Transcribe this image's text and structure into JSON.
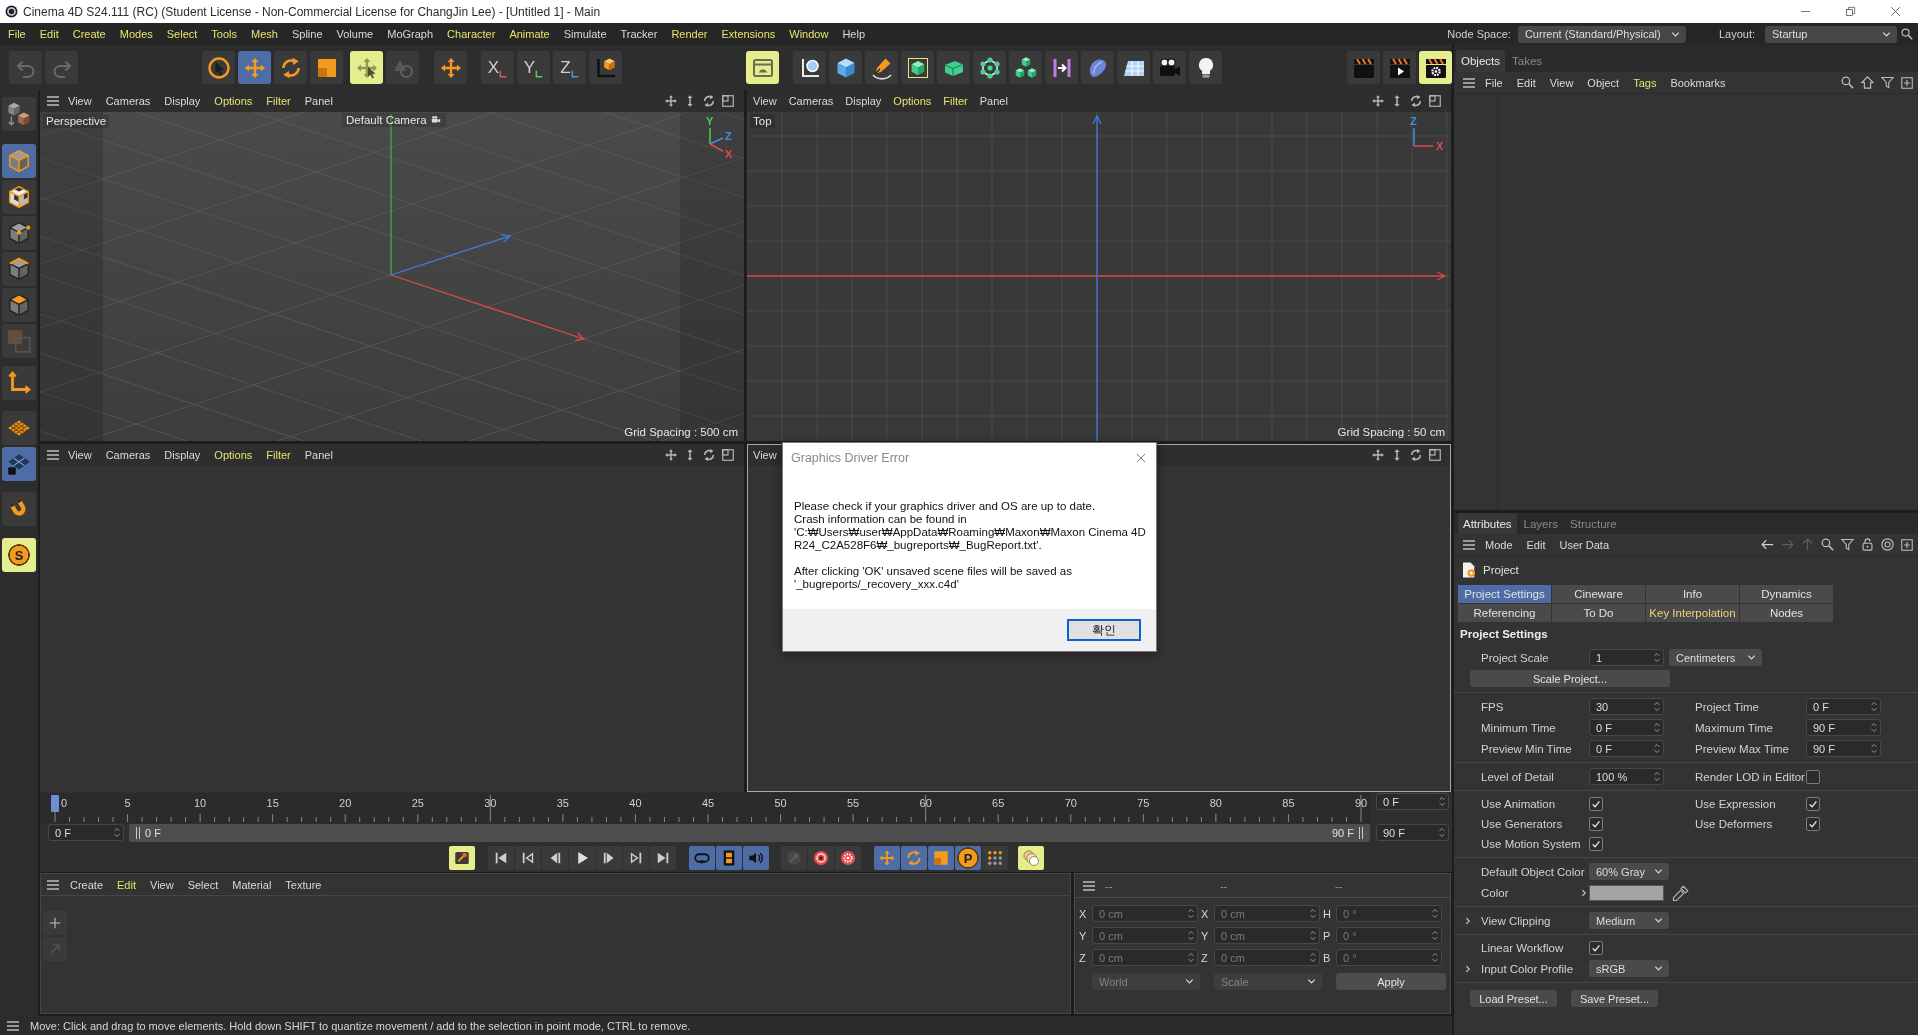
{
  "window": {
    "title": "Cinema 4D S24.111 (RC) (Student License - Non-Commercial License for ChangJin Lee) - [Untitled 1] - Main"
  },
  "menu_bar": {
    "items": [
      {
        "label": "File",
        "highlighted": true
      },
      {
        "label": "Edit",
        "highlighted": true
      },
      {
        "label": "Create",
        "highlighted": true
      },
      {
        "label": "Modes",
        "highlighted": true
      },
      {
        "label": "Select",
        "highlighted": true
      },
      {
        "label": "Tools",
        "highlighted": true
      },
      {
        "label": "Mesh",
        "highlighted": true
      },
      {
        "label": "Spline",
        "highlighted": false
      },
      {
        "label": "Volume",
        "highlighted": false
      },
      {
        "label": "MoGraph",
        "highlighted": false
      },
      {
        "label": "Character",
        "highlighted": true
      },
      {
        "label": "Animate",
        "highlighted": true
      },
      {
        "label": "Simulate",
        "highlighted": false
      },
      {
        "label": "Tracker",
        "highlighted": false
      },
      {
        "label": "Render",
        "highlighted": true
      },
      {
        "label": "Extensions",
        "highlighted": true
      },
      {
        "label": "Window",
        "highlighted": true
      },
      {
        "label": "Help",
        "highlighted": false
      }
    ],
    "node_space": {
      "label": "Node Space:",
      "value": "Current (Standard/Physical)"
    },
    "layout": {
      "label": "Layout:",
      "value": "Startup"
    }
  },
  "toolbar": {
    "groups": [
      [
        {
          "kind": "undo",
          "active": false,
          "highlighted": false,
          "disabled": true
        },
        {
          "kind": "redo",
          "active": false,
          "highlighted": false,
          "disabled": true
        }
      ],
      [
        {
          "kind": "select",
          "active": false,
          "highlighted": false,
          "disabled": false
        },
        {
          "kind": "move",
          "active": true,
          "highlighted": false,
          "disabled": false
        },
        {
          "kind": "rotate",
          "active": false,
          "highlighted": false,
          "disabled": false
        },
        {
          "kind": "scale",
          "active": false,
          "highlighted": false,
          "disabled": false
        }
      ],
      [
        {
          "kind": "live_move",
          "active": false,
          "highlighted": true,
          "disabled": false
        },
        {
          "kind": "transform",
          "active": false,
          "highlighted": false,
          "disabled": true
        }
      ],
      [
        {
          "kind": "axis_move",
          "active": false,
          "highlighted": false,
          "disabled": false
        }
      ],
      [
        {
          "kind": "axis",
          "label": "X",
          "color": "#e0585f",
          "active": false,
          "highlighted": false,
          "disabled": false
        },
        {
          "kind": "axis",
          "label": "Y",
          "color": "#5cc85c",
          "active": false,
          "highlighted": false,
          "disabled": false
        },
        {
          "kind": "axis",
          "label": "Z",
          "color": "#4f95e6",
          "active": false,
          "highlighted": false,
          "disabled": false
        },
        {
          "kind": "coord_system",
          "active": false,
          "highlighted": false,
          "disabled": false
        }
      ],
      [
        {
          "kind": "panel",
          "active": false,
          "highlighted": true,
          "disabled": false
        }
      ],
      [
        {
          "kind": "spline",
          "active": false,
          "highlighted": false,
          "disabled": false
        },
        {
          "kind": "cube",
          "active": false,
          "highlighted": false,
          "disabled": false
        },
        {
          "kind": "pen",
          "active": false,
          "highlighted": false,
          "disabled": false
        },
        {
          "kind": "subdivision",
          "active": false,
          "highlighted": false,
          "disabled": false
        },
        {
          "kind": "extrude",
          "active": false,
          "highlighted": false,
          "disabled": false
        },
        {
          "kind": "cloner",
          "active": false,
          "highlighted": false,
          "disabled": false
        },
        {
          "kind": "blocks",
          "active": false,
          "highlighted": false,
          "disabled": false
        },
        {
          "kind": "deformer",
          "active": false,
          "highlighted": false,
          "disabled": false
        },
        {
          "kind": "field",
          "active": false,
          "highlighted": false,
          "disabled": false
        },
        {
          "kind": "floor",
          "active": false,
          "highlighted": false,
          "disabled": false
        },
        {
          "kind": "camera",
          "active": false,
          "highlighted": false,
          "disabled": false
        },
        {
          "kind": "light",
          "active": false,
          "highlighted": false,
          "disabled": false
        }
      ],
      [
        {
          "kind": "render_view",
          "active": false,
          "highlighted": false,
          "disabled": false
        },
        {
          "kind": "render",
          "active": false,
          "highlighted": false,
          "disabled": false
        },
        {
          "kind": "render_settings",
          "active": false,
          "highlighted": true,
          "disabled": false
        }
      ]
    ]
  },
  "sidebar": {
    "groups": [
      [
        {
          "kind": "make_editable",
          "active": false,
          "highlighted": false
        }
      ],
      [
        {
          "kind": "model",
          "active": true,
          "highlighted": false
        },
        {
          "kind": "texture",
          "active": false,
          "highlighted": false
        },
        {
          "kind": "points",
          "active": false,
          "highlighted": false
        },
        {
          "kind": "edges",
          "active": false,
          "highlighted": false
        },
        {
          "kind": "polygons",
          "active": false,
          "highlighted": false
        },
        {
          "kind": "uv",
          "active": false,
          "highlighted": false
        }
      ],
      [
        {
          "kind": "axis_mode",
          "active": false,
          "highlighted": false
        }
      ],
      [
        {
          "kind": "workplane",
          "active": false,
          "highlighted": false
        },
        {
          "kind": "grid",
          "active": true,
          "highlighted": false
        }
      ],
      [
        {
          "kind": "tweak",
          "active": false,
          "highlighted": false
        }
      ],
      [
        {
          "kind": "snap",
          "label": "S",
          "active": false,
          "highlighted": true
        }
      ]
    ]
  },
  "viewports": [
    {
      "kind": "perspective",
      "active": false,
      "menu": [
        {
          "label": "View",
          "highlighted": false
        },
        {
          "label": "Cameras",
          "highlighted": false
        },
        {
          "label": "Display",
          "highlighted": false
        },
        {
          "label": "Options",
          "highlighted": true
        },
        {
          "label": "Filter",
          "highlighted": true
        },
        {
          "label": "Panel",
          "highlighted": false
        }
      ],
      "label": "Perspective",
      "camera": "Default Camera",
      "axis_labels": [
        {
          "label": "Y",
          "color": "#4fcf4f"
        },
        {
          "label": "Z",
          "color": "#3f8fe6"
        },
        {
          "label": "X",
          "color": "#e24a4a"
        }
      ],
      "grid_spacing": "Grid Spacing : 500 cm"
    },
    {
      "kind": "top",
      "active": false,
      "menu": [
        {
          "label": "View",
          "highlighted": false
        },
        {
          "label": "Cameras",
          "highlighted": false
        },
        {
          "label": "Display",
          "highlighted": false
        },
        {
          "label": "Options",
          "highlighted": true
        },
        {
          "label": "Filter",
          "highlighted": true
        },
        {
          "label": "Panel",
          "highlighted": false
        }
      ],
      "label": "Top",
      "axis_labels": [
        {
          "label": "Z",
          "color": "#3f8fe6"
        },
        {
          "label": "X",
          "color": "#e24a4a"
        }
      ],
      "grid_spacing": "Grid Spacing : 50 cm"
    },
    {
      "kind": "empty",
      "active": false,
      "menu": [
        {
          "label": "View",
          "highlighted": false
        },
        {
          "label": "Cameras",
          "highlighted": false
        },
        {
          "label": "Display",
          "highlighted": false
        },
        {
          "label": "Options",
          "highlighted": true
        },
        {
          "label": "Filter",
          "highlighted": true
        },
        {
          "label": "Panel",
          "highlighted": false
        }
      ]
    },
    {
      "kind": "empty",
      "active": true,
      "menu": [
        {
          "label": "View",
          "highlighted": false
        }
      ]
    }
  ],
  "dialog": {
    "title": "Graphics Driver Error",
    "paragraphs": [
      "Please check if your graphics driver and OS are up to date.\nCrash information can be found in\n'C:₩Users₩user₩AppData₩Roaming₩Maxon₩Maxon Cinema 4D\nR24_C2A528F6₩_bugreports₩_BugReport.txt'.",
      "After clicking 'OK' unsaved scene files will be saved as\n'_bugreports/_recovery_xxx.c4d'"
    ],
    "button": "확인"
  },
  "timeline": {
    "ticks": [
      "0",
      "5",
      "10",
      "15",
      "20",
      "25",
      "30",
      "35",
      "40",
      "45",
      "50",
      "55",
      "60",
      "65",
      "70",
      "75",
      "80",
      "85",
      "90"
    ],
    "playhead": {
      "level": 0
    },
    "current_time": "0 F",
    "start": "0 F",
    "range_start": "0 F",
    "range_end": "90 F",
    "end": "90 F"
  },
  "playback_bar": {
    "groups": [
      [
        {
          "kind": "key_record",
          "active": false,
          "highlighted": true,
          "disabled": false
        }
      ],
      [
        {
          "kind": "first",
          "active": false,
          "highlighted": false,
          "disabled": false
        },
        {
          "kind": "prev_key",
          "active": false,
          "highlighted": false,
          "disabled": false
        },
        {
          "kind": "prev_frame",
          "active": false,
          "highlighted": false,
          "disabled": false
        },
        {
          "kind": "play",
          "active": false,
          "highlighted": false,
          "disabled": false
        },
        {
          "kind": "next_frame",
          "active": false,
          "highlighted": false,
          "disabled": false
        },
        {
          "kind": "next_key",
          "active": false,
          "highlighted": false,
          "disabled": false
        },
        {
          "kind": "last",
          "active": false,
          "highlighted": false,
          "disabled": false
        }
      ],
      [
        {
          "kind": "loop",
          "active": true,
          "highlighted": false,
          "disabled": false
        },
        {
          "kind": "film",
          "active": true,
          "highlighted": false,
          "disabled": false
        },
        {
          "kind": "sound",
          "active": true,
          "highlighted": false,
          "disabled": false
        }
      ],
      [
        {
          "kind": "key",
          "active": false,
          "highlighted": false,
          "disabled": true
        },
        {
          "kind": "record",
          "active": false,
          "highlighted": false,
          "disabled": false
        },
        {
          "kind": "autokey",
          "active": false,
          "highlighted": false,
          "disabled": false
        }
      ],
      [
        {
          "kind": "key_move",
          "active": true,
          "highlighted": false,
          "disabled": false
        },
        {
          "kind": "key_rotate",
          "active": true,
          "highlighted": false,
          "disabled": false
        },
        {
          "kind": "key_scale",
          "active": true,
          "highlighted": false,
          "disabled": false
        },
        {
          "kind": "key_param",
          "label": "P",
          "active": true,
          "highlighted": false,
          "disabled": false
        },
        {
          "kind": "key_points",
          "active": false,
          "highlighted": false,
          "disabled": false
        }
      ],
      [
        {
          "kind": "onion",
          "active": false,
          "highlighted": true,
          "disabled": false
        }
      ]
    ]
  },
  "material_panel": {
    "menu": [
      {
        "label": "Create",
        "highlighted": false
      },
      {
        "label": "Edit",
        "highlighted": true
      },
      {
        "label": "View",
        "highlighted": false
      },
      {
        "label": "Select",
        "highlighted": false
      },
      {
        "label": "Material",
        "highlighted": false
      },
      {
        "label": "Texture",
        "highlighted": false
      }
    ],
    "tools": [
      {
        "kind": "add",
        "disabled": false
      },
      {
        "kind": "arrow",
        "disabled": true
      }
    ]
  },
  "coordinates_panel": {
    "headers": [
      "--",
      "--",
      "--"
    ],
    "rows": [
      [
        {
          "axis": "X",
          "value": "0 cm"
        },
        {
          "axis": "X",
          "value": "0 cm"
        },
        {
          "axis": "H",
          "value": "0 °"
        }
      ],
      [
        {
          "axis": "Y",
          "value": "0 cm"
        },
        {
          "axis": "Y",
          "value": "0 cm"
        },
        {
          "axis": "P",
          "value": "0 °"
        }
      ],
      [
        {
          "axis": "Z",
          "value": "0 cm"
        },
        {
          "axis": "Z",
          "value": "0 cm"
        },
        {
          "axis": "B",
          "value": "0 °"
        }
      ]
    ],
    "dropdowns": [
      "World",
      "Scale"
    ],
    "button": "Apply",
    "disabled": true
  },
  "status_bar": {
    "text": "Move: Click and drag to move elements. Hold down SHIFT to quantize movement / add to the selection in point mode, CTRL to remove."
  },
  "objects_panel": {
    "tabs": [
      {
        "label": "Objects",
        "selected": true
      },
      {
        "label": "Takes",
        "selected": false
      }
    ],
    "menu": [
      {
        "label": "File",
        "highlighted": false
      },
      {
        "label": "Edit",
        "highlighted": false
      },
      {
        "label": "View",
        "highlighted": false
      },
      {
        "label": "Object",
        "highlighted": false
      },
      {
        "label": "Tags",
        "highlighted": true
      },
      {
        "label": "Bookmarks",
        "highlighted": false
      }
    ]
  },
  "attributes_panel": {
    "tabs": [
      {
        "label": "Attributes",
        "selected": true
      },
      {
        "label": "Layers",
        "selected": false
      },
      {
        "label": "Structure",
        "selected": false
      }
    ],
    "menu": [
      {
        "label": "Mode",
        "highlighted": false
      },
      {
        "label": "Edit",
        "highlighted": false
      },
      {
        "label": "User Data",
        "highlighted": false
      }
    ],
    "object": "Project",
    "section_tabs": [
      {
        "label": "Project Settings",
        "selected": true,
        "highlighted": false
      },
      {
        "label": "Cineware",
        "selected": false,
        "highlighted": false
      },
      {
        "label": "Info",
        "selected": false,
        "highlighted": false
      },
      {
        "label": "Dynamics",
        "selected": false,
        "highlighted": false
      },
      {
        "label": "Referencing",
        "selected": false,
        "highlighted": false
      },
      {
        "label": "To Do",
        "selected": false,
        "highlighted": false
      },
      {
        "label": "Key Interpolation",
        "selected": false,
        "highlighted": true
      },
      {
        "label": "Nodes",
        "selected": false,
        "highlighted": false
      }
    ],
    "heading": "Project Settings",
    "groups": [
      [
        {
          "kind": "scale",
          "label": "Project Scale",
          "value": "1",
          "unit": "Centimeters"
        },
        {
          "kind": "button",
          "label": "Scale Project..."
        }
      ],
      [
        {
          "kind": "fields",
          "cells": [
            {
              "kind": "number",
              "label": "FPS",
              "value": "30"
            },
            {
              "kind": "number",
              "label": "Project Time",
              "value": "0 F"
            }
          ]
        },
        {
          "kind": "fields",
          "cells": [
            {
              "kind": "number",
              "label": "Minimum Time",
              "value": "0 F"
            },
            {
              "kind": "number",
              "label": "Maximum Time",
              "value": "90 F"
            }
          ]
        },
        {
          "kind": "fields",
          "cells": [
            {
              "kind": "number",
              "label": "Preview Min Time",
              "value": "0 F"
            },
            {
              "kind": "number",
              "label": "Preview Max Time",
              "value": "90 F"
            }
          ]
        }
      ],
      [
        {
          "kind": "fields",
          "cells": [
            {
              "kind": "number",
              "label": "Level of Detail",
              "value": "100 %"
            },
            {
              "kind": "check",
              "label": "Render LOD in Editor",
              "checked": false
            }
          ]
        }
      ],
      [
        {
          "kind": "checks",
          "cells": [
            {
              "kind": "check",
              "label": "Use Animation",
              "checked": true
            },
            {
              "kind": "check",
              "label": "Use Expression",
              "checked": true
            }
          ]
        },
        {
          "kind": "checks",
          "cells": [
            {
              "kind": "check",
              "label": "Use Generators",
              "checked": true
            },
            {
              "kind": "check",
              "label": "Use Deformers",
              "checked": true
            }
          ]
        },
        {
          "kind": "checks",
          "cells": [
            {
              "kind": "check",
              "label": "Use Motion System",
              "checked": true
            }
          ]
        }
      ],
      [
        {
          "kind": "fields",
          "cells": [
            {
              "kind": "dropdown",
              "label": "Default Object Color",
              "value": "60% Gray"
            }
          ]
        },
        {
          "kind": "fields",
          "cells": [
            {
              "kind": "color",
              "label": "Color",
              "color": "#a4a4a4",
              "expanded": false
            }
          ]
        }
      ],
      [
        {
          "kind": "fields",
          "cells": [
            {
              "kind": "dropdown",
              "label": "View Clipping",
              "value": "Medium",
              "expanded": false
            }
          ]
        }
      ],
      [
        {
          "kind": "checks",
          "cells": [
            {
              "kind": "check",
              "label": "Linear Workflow",
              "checked": true
            }
          ]
        },
        {
          "kind": "fields",
          "cells": [
            {
              "kind": "dropdown",
              "label": "Input Color Profile",
              "value": "sRGB",
              "expanded": false
            }
          ]
        }
      ],
      [
        {
          "kind": "buttons",
          "labels": [
            "Load Preset...",
            "Save Preset..."
          ]
        }
      ]
    ]
  }
}
